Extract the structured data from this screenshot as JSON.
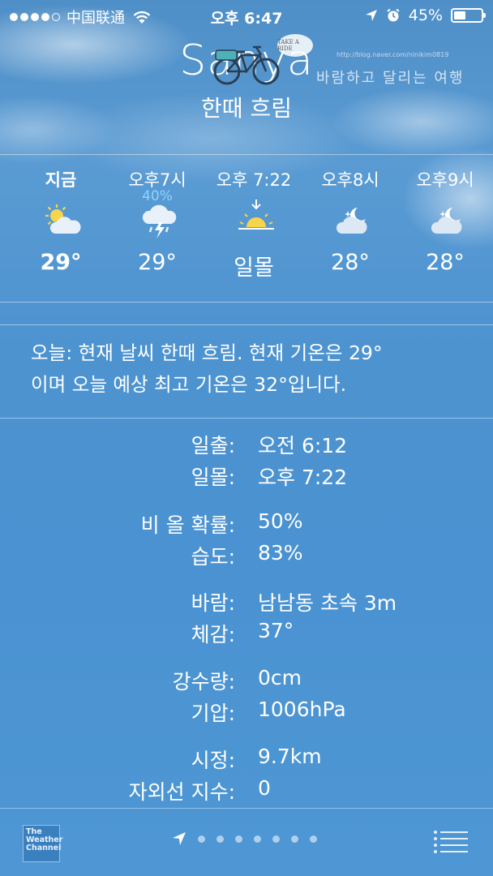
{
  "status_bar": {
    "carrier": "中国联通",
    "time": "오후 6:47",
    "battery_text": "45%",
    "battery_level": 0.45,
    "signal_bars_filled": 4,
    "signal_bars_total": 5
  },
  "header": {
    "city": "Sanya",
    "condition": "한때 흐림",
    "watermark_text": "바람하고 달리는 여행",
    "watermark_url": "http://blog.naver.com/ninikim0819",
    "sticker_text": "TAKE A RIDE"
  },
  "hourly": [
    {
      "time": "지금",
      "icon": "partly-sunny-icon",
      "temp": "29°",
      "pop": "",
      "bold": true
    },
    {
      "time": "오후7시",
      "icon": "thunderstorm-icon",
      "temp": "29°",
      "pop": "40%",
      "bold": false
    },
    {
      "time": "오후 7:22",
      "icon": "sunset-icon",
      "temp": "일몰",
      "pop": "",
      "bold": false
    },
    {
      "time": "오후8시",
      "icon": "partly-cloudy-night-icon",
      "temp": "28°",
      "pop": "",
      "bold": false
    },
    {
      "time": "오후9시",
      "icon": "partly-cloudy-night-icon",
      "temp": "28°",
      "pop": "",
      "bold": false
    }
  ],
  "summary": {
    "line1": "오늘: 현재 날씨 한때 흐림. 현재 기온은 29°",
    "line2": "이며 오늘 예상 최고 기온은 32°입니다."
  },
  "details": [
    {
      "key": "일출:",
      "value": "오전 6:12"
    },
    {
      "key": "일몰:",
      "value": "오후 7:22"
    },
    {
      "key": "비 올 확률:",
      "value": "50%"
    },
    {
      "key": "습도:",
      "value": "83%"
    },
    {
      "key": "바람:",
      "value": "남남동 초속 3m"
    },
    {
      "key": "체감:",
      "value": "37°"
    },
    {
      "key": "강수량:",
      "value": "0cm"
    },
    {
      "key": "기압:",
      "value": "1006hPa"
    },
    {
      "key": "시정:",
      "value": "9.7km"
    },
    {
      "key": "자외선 지수:",
      "value": "0"
    }
  ],
  "bottom_bar": {
    "logo_text": "The Weather Channel",
    "page_count": 7
  }
}
